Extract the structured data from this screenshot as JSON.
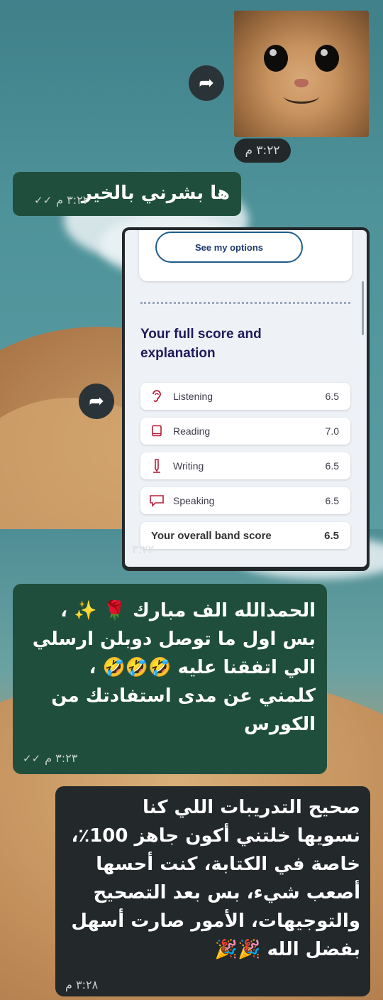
{
  "messages": {
    "image_msg": {
      "time": "٣:٢٢ م"
    },
    "text_1": {
      "text": "ها بشرني بالخير",
      "time": "٣:٢٢ م"
    },
    "screenshot_msg": {
      "time": "٣:٢٢"
    },
    "text_2": {
      "lines": [
        "الحمدالله الف مبارك 🌹 ✨ ،",
        "بس اول ما توصل دوبلن ارسلي",
        "الي اتفقنا عليه 🤣🤣🤣 ،",
        "كلمني عن مدى استفادتك من",
        "الكورس"
      ],
      "time": "٣:٢٣ م"
    },
    "text_3": {
      "lines": [
        "صحيح التدريبات اللي كنا",
        "نسويها خلتني أكون جاهز 100٪،",
        "خاصة في الكتابة، كنت أحسها",
        "أصعب شيء، بس بعد التصحيح",
        "والتوجيهات، الأمور صارت أسهل",
        "بفضل الله 🎉🎉"
      ],
      "time": "٣:٢٨ م"
    }
  },
  "score_screen": {
    "options_button": "See my options",
    "title": "Your full score and explanation",
    "rows": [
      {
        "label": "Listening",
        "value": "6.5",
        "icon": "ear-icon"
      },
      {
        "label": "Reading",
        "value": "7.0",
        "icon": "book-icon"
      },
      {
        "label": "Writing",
        "value": "6.5",
        "icon": "pen-icon"
      },
      {
        "label": "Speaking",
        "value": "6.5",
        "icon": "speech-bubble-icon"
      }
    ],
    "overall": {
      "label": "Your overall band score",
      "value": "6.5"
    }
  },
  "icons": {
    "forward": "forward-arrow-icon",
    "read_receipt": "double-check-icon"
  },
  "colors": {
    "outgoing_bubble": "#1f4f3c",
    "incoming_bubble": "#23282b",
    "score_title": "#231a5a",
    "icon_red": "#b3203a"
  }
}
